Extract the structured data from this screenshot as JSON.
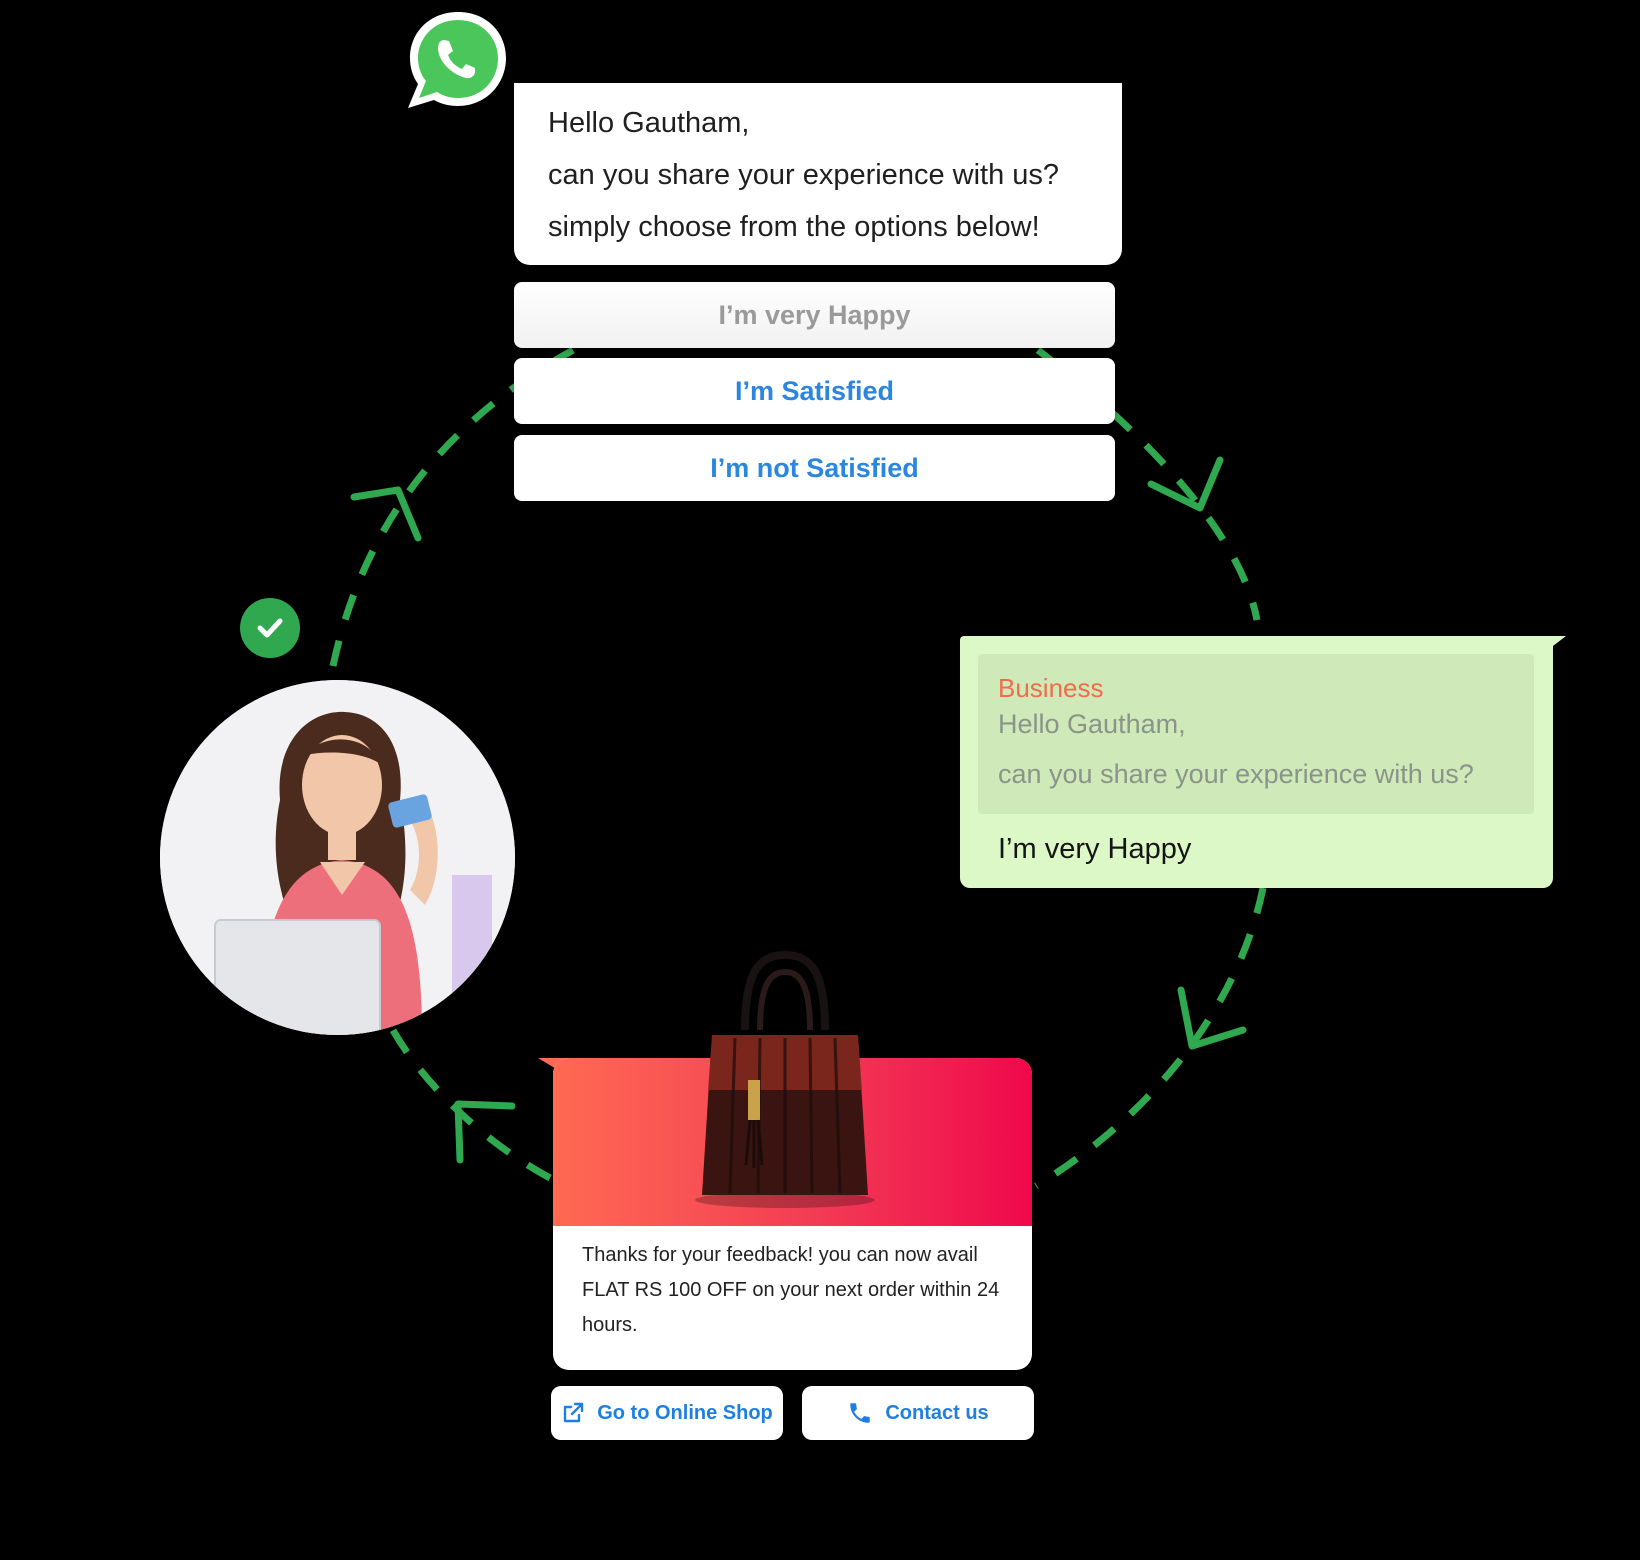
{
  "colors": {
    "accent_green": "#2fa84f",
    "whatsapp_green": "#4bc65a",
    "reply_bg": "#dcf8c6",
    "link_blue": "#2a86df",
    "banner_gradient": [
      "#ff6a52",
      "#f0084c"
    ]
  },
  "message": {
    "greeting": "Hello Gautham,",
    "line2": "can you share your experience with us?",
    "line3": "simply choose from the options below!"
  },
  "options": [
    {
      "label": "I’m very Happy",
      "state": "selected"
    },
    {
      "label": "I’m Satisfied"
    },
    {
      "label": "I’m not Satisfied"
    }
  ],
  "reply": {
    "quoted_sender": "Business",
    "quoted_line1": "Hello Gautham,",
    "quoted_line2": "can you share your experience with us?",
    "text": "I’m very Happy"
  },
  "offer": {
    "text": "Thanks for your feedback! you can now avail FLAT RS 100 OFF on your next order within 24 hours."
  },
  "actions": {
    "shop_label": "Go to Online Shop",
    "shop_icon": "external-link-icon",
    "contact_label": "Contact us",
    "contact_icon": "phone-icon"
  },
  "icons": {
    "logo": "whatsapp-logo",
    "status": "check-circle-icon"
  }
}
